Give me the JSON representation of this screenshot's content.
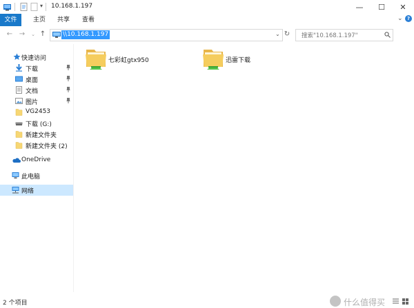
{
  "window": {
    "title": "10.168.1.197",
    "controls": {
      "minimize": "—",
      "maximize": "☐",
      "close": "✕"
    }
  },
  "ribbon": {
    "tabs": [
      {
        "label": "文件",
        "active": true
      },
      {
        "label": "主页"
      },
      {
        "label": "共享"
      },
      {
        "label": "查看"
      }
    ],
    "expand_icon": "chevron-down-icon",
    "accent_color": "#1979ca"
  },
  "address_bar": {
    "path": "\\\\10.168.1.197",
    "search_placeholder": "搜索\"10.168.1.197\""
  },
  "nav_pane": {
    "items": [
      {
        "label": "快速访问",
        "icon": "star-icon"
      },
      {
        "label": "下载",
        "icon": "download-arrow-icon",
        "pinned": true
      },
      {
        "label": "桌面",
        "icon": "desktop-icon",
        "pinned": true
      },
      {
        "label": "文档",
        "icon": "document-icon",
        "pinned": true
      },
      {
        "label": "图片",
        "icon": "pictures-icon",
        "pinned": true
      },
      {
        "label": "VG2453",
        "icon": "folder-icon"
      },
      {
        "label": "下载 (G:)",
        "icon": "drive-icon"
      },
      {
        "label": "新建文件夹",
        "icon": "folder-icon"
      },
      {
        "label": "新建文件夹 (2)",
        "icon": "folder-icon"
      },
      {
        "label": "OneDrive",
        "icon": "cloud-icon"
      },
      {
        "label": "此电脑",
        "icon": "computer-icon"
      },
      {
        "label": "网络",
        "icon": "network-icon",
        "selected": true
      }
    ]
  },
  "content": {
    "items": [
      {
        "label": "七彩虹gtx950",
        "type": "shared-folder"
      },
      {
        "label": "迅雷下载",
        "type": "shared-folder"
      }
    ]
  },
  "status_bar": {
    "text": "2 个项目",
    "watermark": "什么值得买"
  }
}
